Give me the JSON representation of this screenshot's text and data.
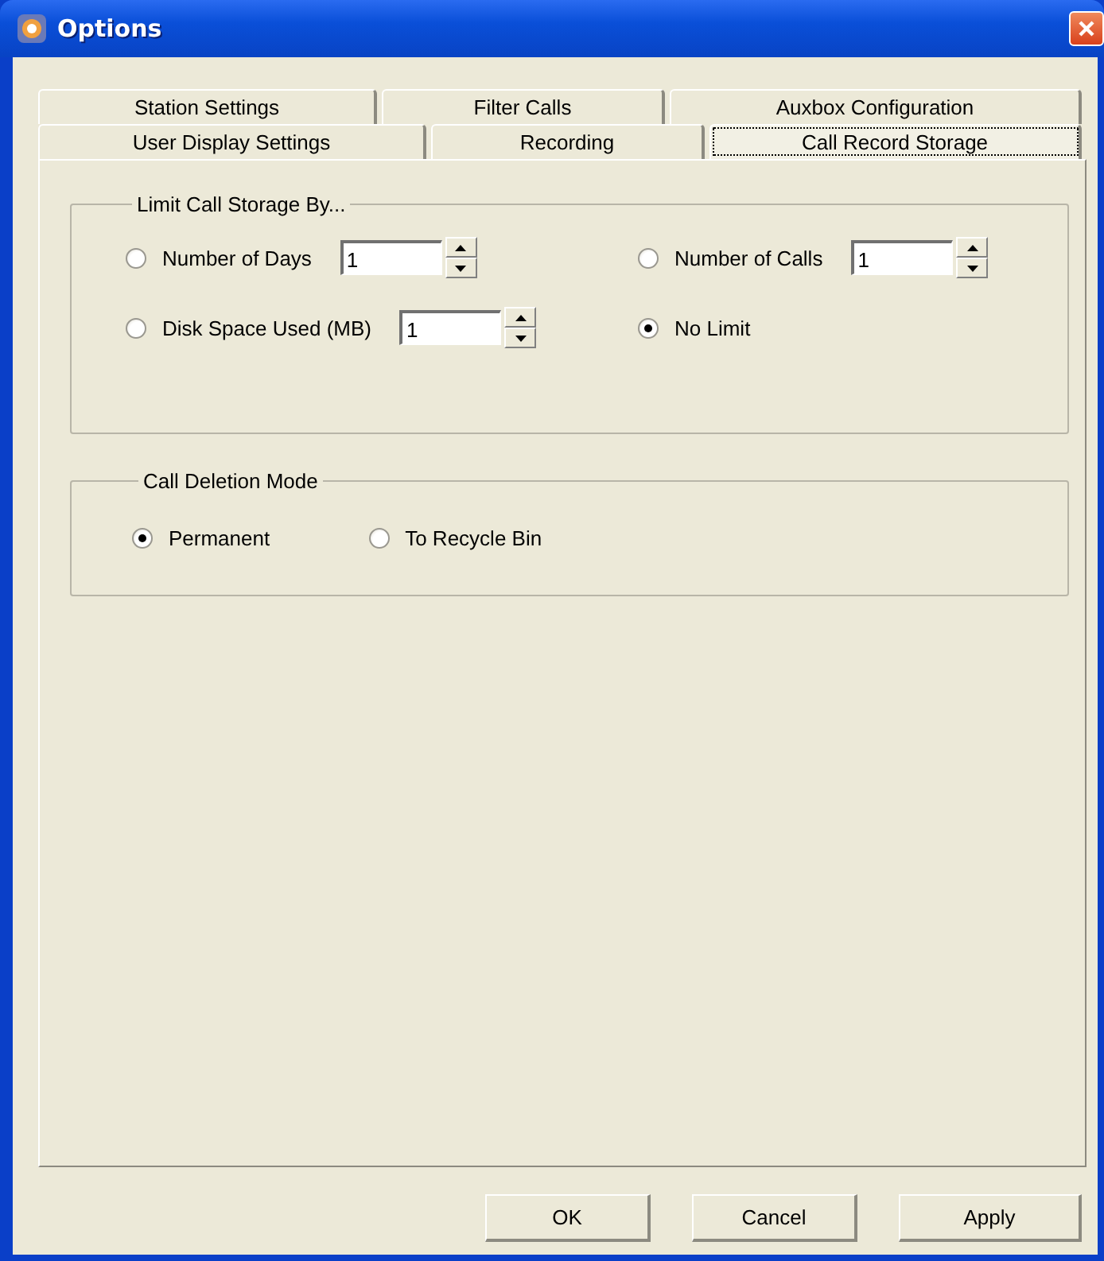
{
  "window": {
    "title": "Options"
  },
  "tab_rows": [
    [
      {
        "label": "Station Settings",
        "selected": false
      },
      {
        "label": "Filter Calls",
        "selected": false
      },
      {
        "label": "Auxbox Configuration",
        "selected": false
      }
    ],
    [
      {
        "label": "User Display Settings",
        "selected": false
      },
      {
        "label": "Recording",
        "selected": false
      },
      {
        "label": "Call Record Storage",
        "selected": true
      }
    ]
  ],
  "limit_group": {
    "title": "Limit Call Storage By...",
    "options": [
      {
        "kind": "spin",
        "label": "Number of Days",
        "value": "1",
        "selected": false
      },
      {
        "kind": "spin",
        "label": "Number of Calls",
        "value": "1",
        "selected": false
      },
      {
        "kind": "spin",
        "label": "Disk Space Used (MB)",
        "value": "1",
        "selected": false
      },
      {
        "kind": "plain",
        "label": "No Limit",
        "selected": true
      }
    ]
  },
  "deletion_group": {
    "title": "Call Deletion Mode",
    "options": [
      {
        "label": "Permanent",
        "selected": true
      },
      {
        "label": "To Recycle Bin",
        "selected": false
      }
    ]
  },
  "buttons": [
    "OK",
    "Cancel",
    "Apply"
  ]
}
